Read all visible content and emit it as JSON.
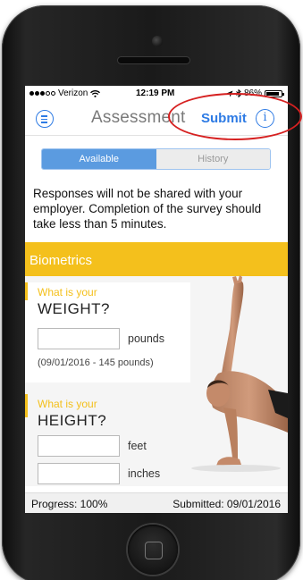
{
  "status_bar": {
    "carrier": "Verizon",
    "time": "12:19 PM",
    "battery": "86%"
  },
  "nav": {
    "title": "Assessment",
    "submit_label": "Submit",
    "info_glyph": "i"
  },
  "tabs": [
    {
      "label": "Available",
      "active": true
    },
    {
      "label": "History",
      "active": false
    }
  ],
  "notice": "Responses will not be shared with your employer.  Completion of the survey should take less than 5 minutes.",
  "section": {
    "title": "Biometrics"
  },
  "questions": {
    "weight": {
      "prompt": "What is your",
      "label": "WEIGHT?",
      "unit": "pounds",
      "hint": "(09/01/2016 - 145 pounds)",
      "value": ""
    },
    "height": {
      "prompt": "What is your",
      "label": "HEIGHT?",
      "unit_feet": "feet",
      "unit_inches": "inches",
      "feet_value": "",
      "inches_value": ""
    }
  },
  "footer": {
    "progress": "Progress: 100%",
    "submitted": "Submitted: 09/01/2016"
  },
  "colors": {
    "accent_blue": "#2e7be4",
    "section_yellow": "#f4c01c",
    "annotation_red": "#d62121"
  },
  "icons": {
    "menu": "hamburger-menu-icon",
    "info": "info-icon",
    "wifi": "wifi-icon",
    "location": "location-arrow-icon",
    "bluetooth": "bluetooth-icon",
    "battery": "battery-icon"
  }
}
